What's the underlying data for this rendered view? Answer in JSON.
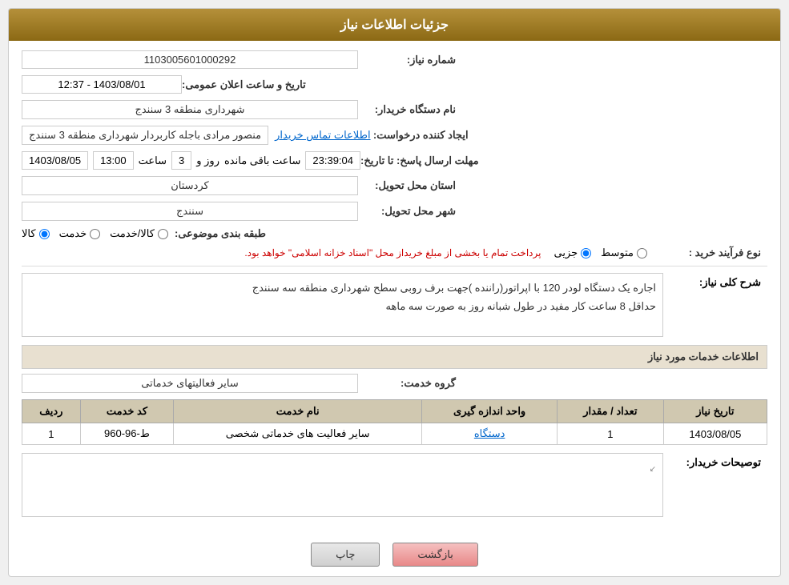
{
  "page": {
    "title": "جزئیات اطلاعات نیاز",
    "header": {
      "label": "جزئیات اطلاعات نیاز"
    }
  },
  "fields": {
    "need_number_label": "شماره نیاز:",
    "need_number_value": "1103005601000292",
    "announcement_label": "تاریخ و ساعت اعلان عمومی:",
    "announcement_value": "1403/08/01 - 12:37",
    "buyer_org_label": "نام دستگاه خریدار:",
    "buyer_org_value": "شهرداری منطقه 3 سنندج",
    "creator_label": "ایجاد کننده درخواست:",
    "creator_value": "منصور مرادی باجله کاربردار شهرداری منطقه 3 سنندج",
    "creator_link": "اطلاعات تماس خریدار",
    "deadline_label": "مهلت ارسال پاسخ: تا تاریخ:",
    "deadline_date": "1403/08/05",
    "deadline_time_label": "ساعت",
    "deadline_time": "13:00",
    "deadline_day_label": "روز و",
    "deadline_days": "3",
    "deadline_remaining_label": "ساعت باقی مانده",
    "deadline_remaining": "23:39:04",
    "province_label": "استان محل تحویل:",
    "province_value": "کردستان",
    "city_label": "شهر محل تحویل:",
    "city_value": "سنندج",
    "category_label": "طبقه بندی موضوعی:",
    "category_goods": "کالا",
    "category_service": "خدمت",
    "category_goods_service": "کالا/خدمت",
    "purchase_type_label": "نوع فرآیند خرید :",
    "purchase_type_partial": "جزیی",
    "purchase_type_medium": "متوسط",
    "purchase_notice": "پرداخت تمام یا بخشی از مبلغ خریداز محل \"اسناد خزانه اسلامی\" خواهد بود.",
    "description_section": "شرح کلی نیاز:",
    "description_text": "اجاره یک دستگاه لودر 120 با اپراتور(راننده )جهت برف روبی سطح شهرداری منطقه سه سنندج\nحداقل 8 ساعت کار مفید در طول شبانه روز به صورت سه ماهه",
    "services_section_label": "اطلاعات خدمات مورد نیاز",
    "service_group_label": "گروه خدمت:",
    "service_group_value": "سایر فعالیتهای خدماتی",
    "table": {
      "col_row": "ردیف",
      "col_code": "کد خدمت",
      "col_name": "نام خدمت",
      "col_unit": "واحد اندازه گیری",
      "col_qty": "تعداد / مقدار",
      "col_date": "تاریخ نیاز",
      "rows": [
        {
          "row": "1",
          "code": "ط-96-960",
          "name": "سایر فعالیت های خدماتی شخصی",
          "unit": "دستگاه",
          "qty": "1",
          "date": "1403/08/05"
        }
      ]
    },
    "buyer_notes_label": "توصیحات خریدار:",
    "buyer_notes_value": "",
    "btn_print": "چاپ",
    "btn_back": "بازگشت"
  }
}
